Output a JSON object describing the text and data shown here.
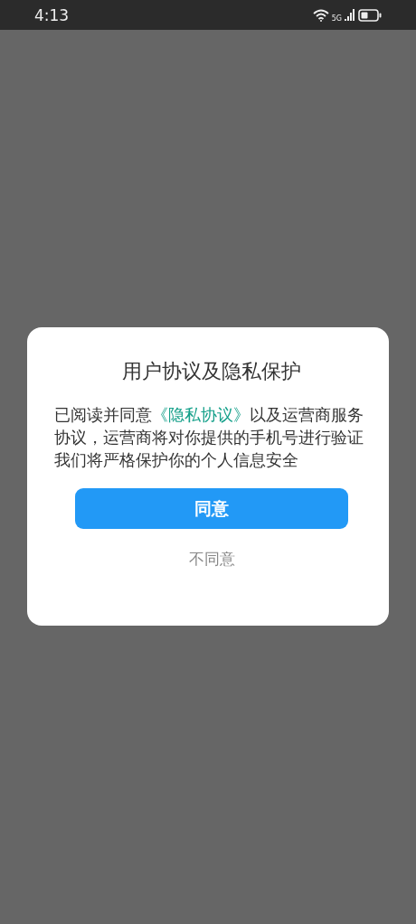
{
  "status_bar": {
    "time": "4:13",
    "network": "5G"
  },
  "dialog": {
    "title": "用户协议及隐私保护",
    "message": {
      "before": "已阅读并同意",
      "link": "《隐私协议》",
      "after": "以及运营商服务协议，运营商将对你提供的手机号进行验证"
    },
    "note": "我们将严格保护你的个人信息安全",
    "agree_button": "同意",
    "decline_button": "不同意"
  }
}
